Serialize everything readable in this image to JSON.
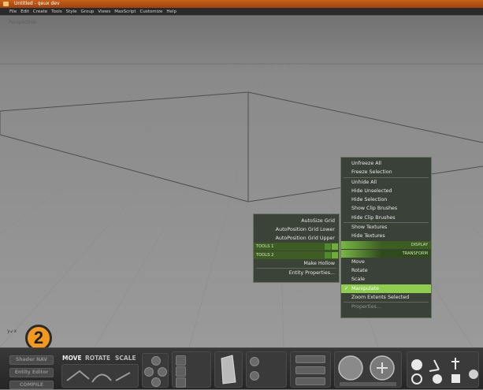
{
  "window": {
    "title": "Untitled - qeux dev"
  },
  "menu": [
    "File",
    "Edit",
    "Create",
    "Tools",
    "Style",
    "Group",
    "Views",
    "MaxScript",
    "Customize",
    "Help"
  ],
  "viewport": {
    "label": "Perspective",
    "axis": "y↙x"
  },
  "badge": {
    "number": "2"
  },
  "left_menu": {
    "items_top": [
      "AutoSize Grid",
      "AutoPosition Grid Lower",
      "AutoPosition Grid Upper"
    ],
    "tools": [
      "TOOLS 1",
      "TOOLS 2"
    ],
    "items_bottom": [
      "Make Hollow",
      "Entity Properties..."
    ]
  },
  "right_menu": {
    "group1": [
      "Unfreeze All",
      "Freeze Selection"
    ],
    "group2": [
      "Unhide All",
      "Hide Unselected",
      "Hide Selection",
      "Show Clip Brushes",
      "Hide Clip Brushes"
    ],
    "group3": [
      "Show Textures",
      "Hide Textures"
    ],
    "header_display": "DISPLAY",
    "header_transform": "TRANSFORM",
    "transform": [
      "Move",
      "Rotate",
      "Scale",
      "Manipulate"
    ],
    "active_index": 3,
    "check": "✓",
    "after": [
      "Zoom Extents Selected"
    ],
    "disabled": [
      "Properties..."
    ]
  },
  "toolbar": {
    "buttons": [
      "Shader NAV",
      "Entity Editor",
      "COMPILE"
    ],
    "modes": [
      "MOVE",
      "ROTATE",
      "SCALE"
    ]
  },
  "colors": {
    "accent": "#8fcd4f",
    "menu_bg": "#3a4138",
    "badge": "#f39a1e"
  }
}
